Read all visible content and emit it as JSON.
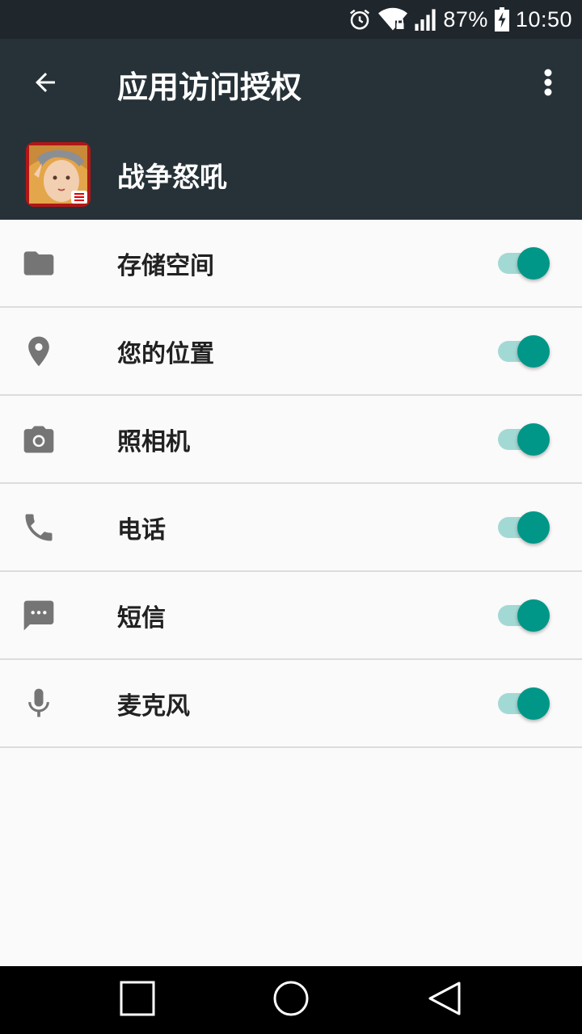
{
  "status_bar": {
    "battery_percent": "87%",
    "time": "10:50",
    "icons": [
      "alarm-icon",
      "wifi-icon",
      "signal-icon",
      "battery-charging-icon"
    ]
  },
  "toolbar": {
    "title": "应用访问授权",
    "back_icon": "arrow-back-icon",
    "more_icon": "more-vert-icon"
  },
  "app": {
    "name": "战争怒吼"
  },
  "permissions": [
    {
      "label": "存储空间",
      "icon": "folder-icon",
      "enabled": true
    },
    {
      "label": "您的位置",
      "icon": "location-icon",
      "enabled": true
    },
    {
      "label": "照相机",
      "icon": "camera-icon",
      "enabled": true
    },
    {
      "label": "电话",
      "icon": "phone-icon",
      "enabled": true
    },
    {
      "label": "短信",
      "icon": "sms-icon",
      "enabled": true
    },
    {
      "label": "麦克风",
      "icon": "microphone-icon",
      "enabled": true
    }
  ],
  "nav_bar": {
    "icons": [
      "recents-icon",
      "home-icon",
      "back-icon"
    ]
  },
  "colors": {
    "toolbar": "#263238",
    "accent": "#009688",
    "accent_track": "#a3d9d4",
    "background": "#fafafa"
  }
}
